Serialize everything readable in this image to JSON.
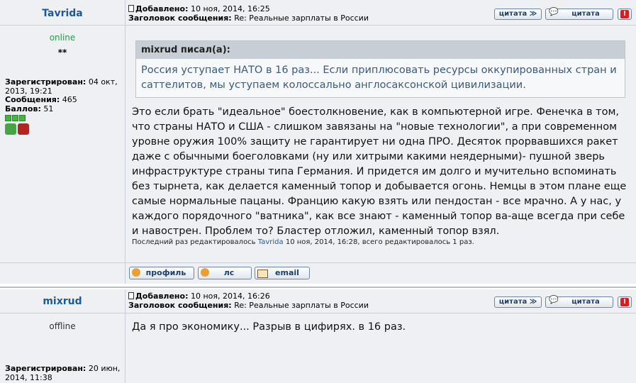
{
  "posts": [
    {
      "author": "Tavrida",
      "status": "online",
      "stars": "**",
      "registered_label": "Зарегистрирован:",
      "registered_value": "04 окт, 2013, 19:21",
      "messages_label": "Сообщения:",
      "messages_value": "465",
      "points_label": "Баллов:",
      "points_value": "51",
      "added_label": "Добавлено:",
      "added_value": "10 ноя, 2014, 16:25",
      "subject_label": "Заголовок сообщения:",
      "subject_value": "Re: Реальные зарплаты в России",
      "quote_author": "mixrud писал(а):",
      "quote_text": "Россия уступает НАТО в 16 раз... Если приплюсовать ресурсы оккупированных стран и саттелитов, мы уступаем колоссально англосаксонской цивилизации.",
      "body": "Это если брать \"идеальное\" боестолкновение, как в компьютерной игре. Фенечка в том, что страны НАТО и США - слишком завязаны на \"новые технологии\", а при современном уровне оружия 100% защиту не гарантирует ни одна ПРО. Десяток прорвавшихся ракет даже с обычными боеголовками (ну или хитрыми какими неядерными)- пушной зверь инфраструктуре страны типа Германия. И придется им долго и мучительно вспоминать без тырнета, как делается каменный топор и добывается огонь. Немцы в этом плане еще самые нормальные пацаны. Францию какую взять или пендостан - все мрачно. А у нас, у каждого порядочного \"ватника\", как все знают - каменный топор ва-аще всегда при себе и навострен. Проблем то? Бластер отложил, каменный топор взял.",
      "edit_prefix": "Последний раз редактировалось",
      "edit_user": "Tavrida",
      "edit_suffix": "10 ноя, 2014, 16:28, всего редактировалось 1 раз."
    },
    {
      "author": "mixrud",
      "status": "offline",
      "registered_label": "Зарегистрирован:",
      "registered_value": "20 июн, 2014, 11:38",
      "added_label": "Добавлено:",
      "added_value": "10 ноя, 2014, 16:26",
      "subject_label": "Заголовок сообщения:",
      "subject_value": "Re: Реальные зарплаты в России",
      "body": "Да я про экономику... Разрыв в цифирях. в 16 раз."
    }
  ],
  "buttons": {
    "quote_multi": "цитата",
    "quote": "цитата",
    "report": "!",
    "profile": "профиль",
    "pm": "лс",
    "email": "email"
  },
  "colors": {
    "author": "#1e5a96",
    "online": "#2a9a4a",
    "panel_bg": "#eef0f3",
    "quote_head": "#c7ced6",
    "quote_text": "#3c5a7a"
  },
  "icons": [
    "document-icon",
    "multi-quote-icon",
    "quote-bubble-icon",
    "report-icon",
    "profile-icon",
    "pm-icon",
    "email-icon",
    "thumbs-up-icon",
    "thumbs-down-icon"
  ]
}
